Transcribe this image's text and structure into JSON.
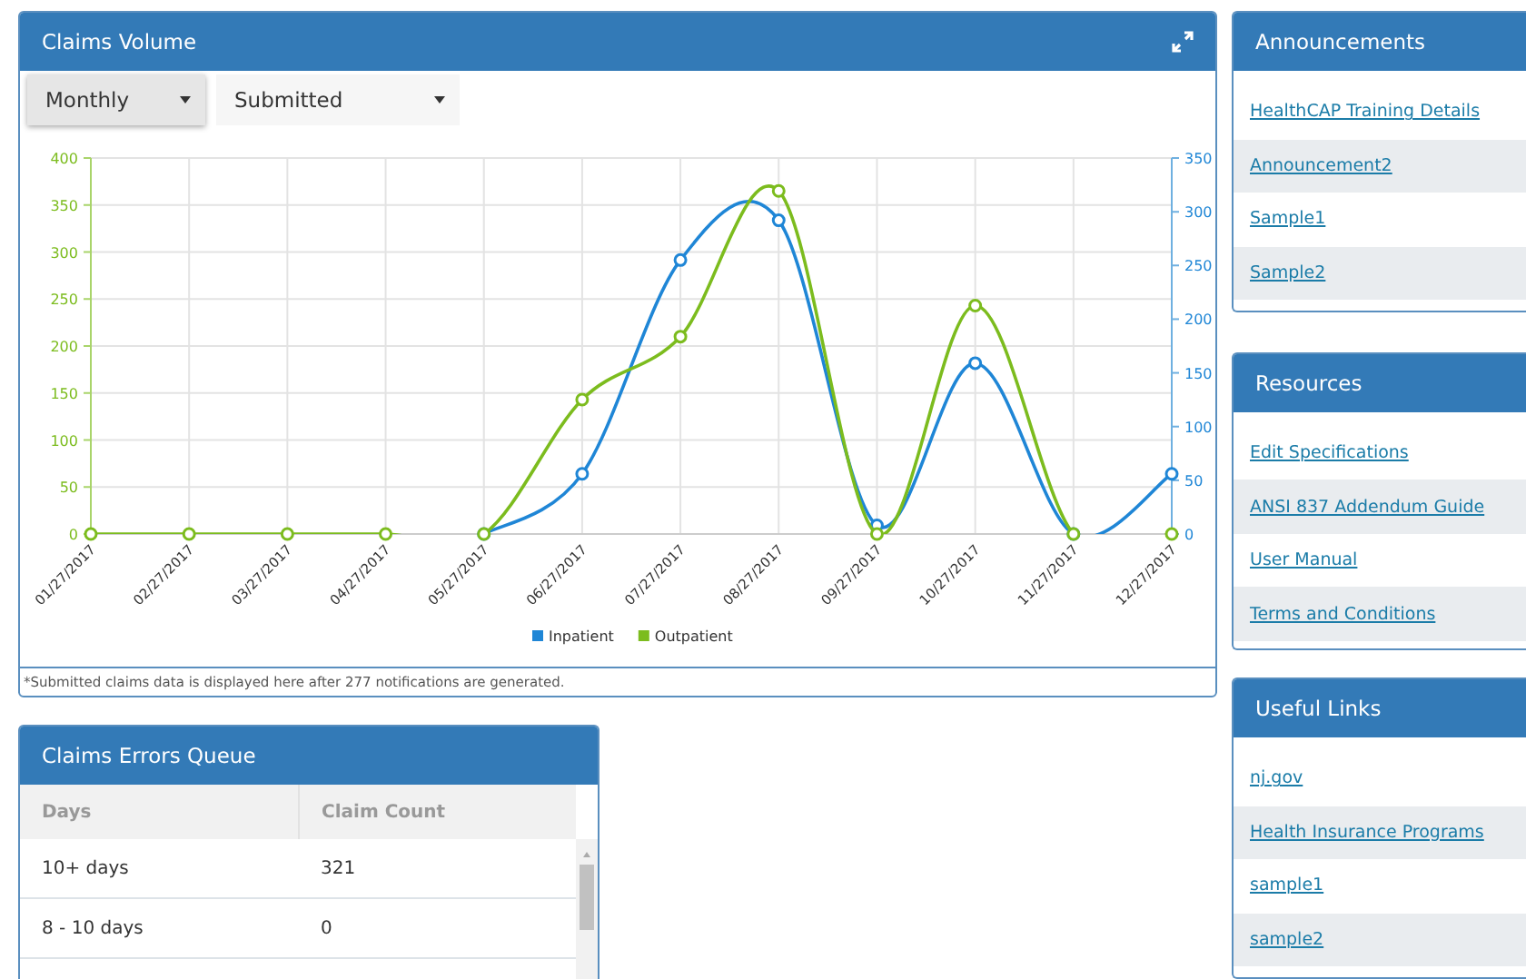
{
  "claims_volume": {
    "title": "Claims Volume",
    "filters": [
      {
        "value": "Monthly",
        "active": true
      },
      {
        "value": "Submitted",
        "active": false
      }
    ],
    "chart_data": {
      "type": "line",
      "categories": [
        "01/27/2017",
        "02/27/2017",
        "03/27/2017",
        "04/27/2017",
        "05/27/2017",
        "06/27/2017",
        "07/27/2017",
        "08/27/2017",
        "09/27/2017",
        "10/27/2017",
        "11/27/2017",
        "12/27/2017"
      ],
      "series": [
        {
          "name": "Inpatient",
          "color": "#1f86d6",
          "axis": "y2",
          "marker": "circle",
          "values": [
            null,
            null,
            null,
            null,
            0,
            56,
            255,
            292,
            8,
            159,
            0,
            56
          ]
        },
        {
          "name": "Outpatient",
          "color": "#7cbc1e",
          "marker": "circle",
          "values": [
            0,
            0,
            0,
            0,
            0,
            143,
            210,
            365,
            0,
            243,
            0,
            0
          ]
        }
      ],
      "grid": true,
      "legend": true,
      "ylim": [
        0,
        400
      ],
      "yticks": [
        0,
        50,
        100,
        150,
        200,
        250,
        300,
        350,
        400
      ],
      "y2lim": [
        0,
        350
      ],
      "y2ticks": [
        0,
        50,
        100,
        150,
        200,
        250,
        300,
        350
      ]
    },
    "footnote": "*Submitted claims data is displayed here after 277 notifications are generated."
  },
  "claims_errors_queue": {
    "title": "Claims Errors Queue",
    "columns": [
      "Days",
      "Claim Count"
    ],
    "rows": [
      [
        "10+ days",
        "321"
      ],
      [
        "8 - 10 days",
        "0"
      ]
    ]
  },
  "announcements": {
    "title": "Announcements",
    "links": [
      "HealthCAP Training Details",
      "Announcement2",
      "Sample1",
      "Sample2"
    ]
  },
  "resources": {
    "title": "Resources",
    "links": [
      "Edit Specifications",
      "ANSI 837 Addendum Guide",
      "User Manual",
      "Terms and Conditions"
    ]
  },
  "useful_links": {
    "title": "Useful Links",
    "links": [
      "nj.gov",
      "Health Insurance Programs",
      "sample1",
      "sample2"
    ]
  }
}
